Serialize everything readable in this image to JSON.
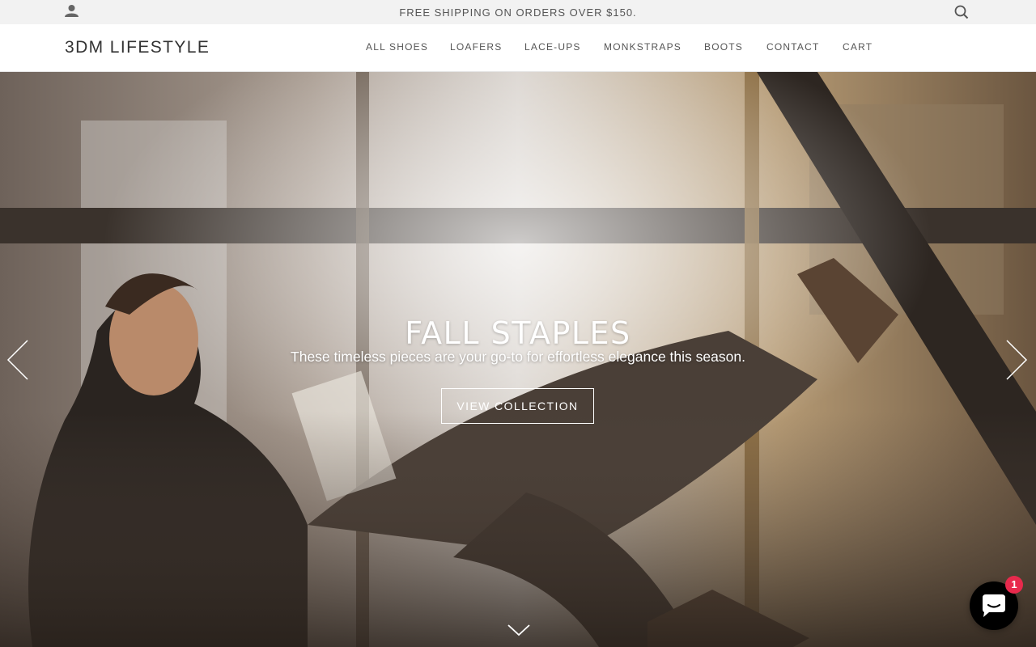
{
  "announcement": {
    "text": "FREE SHIPPING ON ORDERS OVER $150."
  },
  "header": {
    "logo": "3DM LIFESTYLE",
    "nav": [
      {
        "label": "ALL SHOES"
      },
      {
        "label": "LOAFERS"
      },
      {
        "label": "LACE-UPS"
      },
      {
        "label": "MONKSTRAPS"
      },
      {
        "label": "BOOTS"
      },
      {
        "label": "CONTACT"
      },
      {
        "label": "CART"
      }
    ]
  },
  "hero": {
    "title": "FALL STAPLES",
    "subtitle": "These timeless pieces are your go-to for effortless elegance this season.",
    "button_label": "VIEW COLLECTION"
  },
  "chat": {
    "badge_count": "1"
  },
  "icons": {
    "account": "account-icon",
    "search": "search-icon",
    "prev": "chevron-left-icon",
    "next": "chevron-right-icon",
    "scroll": "chevron-down-icon",
    "chat": "chat-icon"
  },
  "colors": {
    "badge": "#e8294c",
    "topbar": "#f2f2f2",
    "text": "#555555"
  }
}
